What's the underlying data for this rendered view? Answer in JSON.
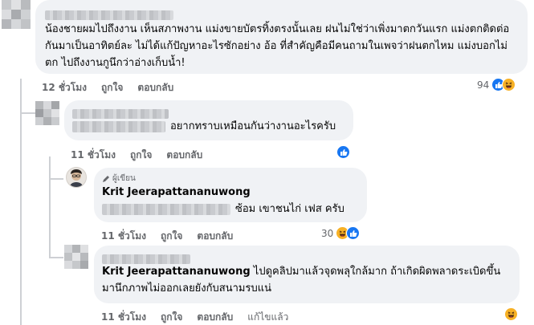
{
  "comments": [
    {
      "author_hidden": true,
      "text": "น้องชายผมไปถึงงาน เห็นสภาพงาน แม่งขายบัตรทิ้งตรงนั้นเลย ฝนไม่ใช่ว่าเพิ่งมาตกวันแรก แม่งตกติดต่อกันมาเป็นอาทิตย์ละ ไม่ได้แก้ปัญหาอะไรซักอย่าง อ้อ ที่สำคัญคือมีคนถามในเพจว่าฝนตกไหม แม่งบอกไม่ตก ไปถึงงานกูนึกว่าอ่างเก็บน้ำ!",
      "time": "12 ชั่วโมง",
      "like": "ถูกใจ",
      "reply": "ตอบกลับ",
      "reaction_count": "94",
      "reactions": [
        "like-icon",
        "haha-icon"
      ]
    },
    {
      "author_hidden": true,
      "text": "อยากทราบเหมือนกันว่างานอะไรครับ",
      "time": "11 ชั่วโมง",
      "like": "ถูกใจ",
      "reply": "ตอบกลับ",
      "reactions": [
        "like-icon"
      ]
    },
    {
      "badge": "ผู้เขียน",
      "author": "Krit Jeerapattananuwong",
      "text": "ซ้อม เขาชนไก่ เฟส ครับ",
      "time": "11 ชั่วโมง",
      "like": "ถูกใจ",
      "reply": "ตอบกลับ",
      "reaction_count": "30",
      "reactions": [
        "haha-icon",
        "like-icon"
      ]
    },
    {
      "author_hidden": true,
      "mention": "Krit Jeerapattananuwong",
      "text": " ไปดูคลิปมาแล้วจุดพลุใกล้มาก ถ้าเกิดผิดพลาดระเบิดขึ้นมานึกภาพไม่ออกเลยยังกับสนามรบแน่",
      "time": "11 ชั่วโมง",
      "like": "ถูกใจ",
      "reply": "ตอบกลับ",
      "edited": "แก้ไขแล้ว",
      "reactions": [
        "haha-icon"
      ]
    }
  ],
  "colors": {
    "bubble": "#f0f2f5",
    "secondary_text": "#65676b",
    "like_blue": "#1877f2",
    "haha_yellow": "#f7b125"
  }
}
